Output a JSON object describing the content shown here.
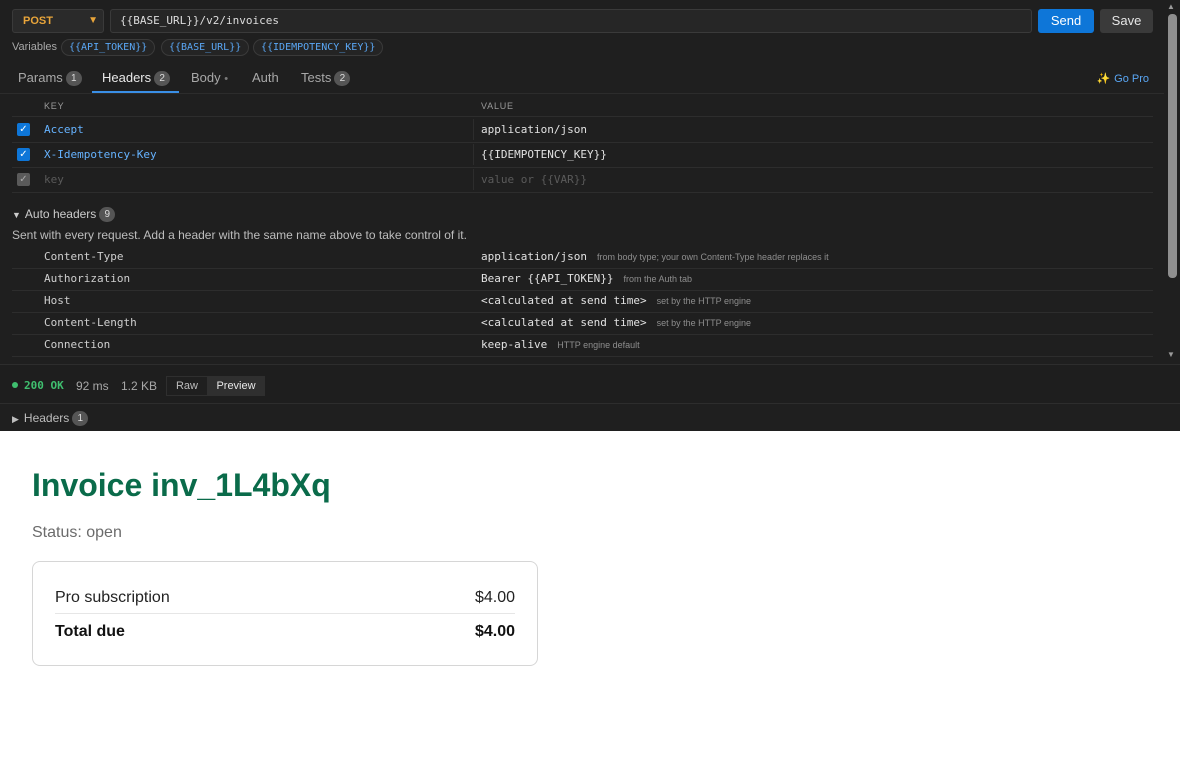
{
  "request": {
    "method": "POST",
    "url": "{{BASE_URL}}/v2/invoices",
    "send_label": "Send",
    "save_label": "Save"
  },
  "variables": {
    "label": "Variables",
    "items": [
      "{{API_TOKEN}}",
      "{{BASE_URL}}",
      "{{IDEMPOTENCY_KEY}}"
    ]
  },
  "tabs": [
    {
      "label": "Params",
      "badge": "1"
    },
    {
      "label": "Headers",
      "badge": "2",
      "active": true
    },
    {
      "label": "Body",
      "dot": "•"
    },
    {
      "label": "Auth"
    },
    {
      "label": "Tests",
      "badge": "2"
    }
  ],
  "go_pro": "Go Pro",
  "headers_table": {
    "col_key": "KEY",
    "col_value": "VALUE",
    "rows": [
      {
        "key": "Accept",
        "value": "application/json",
        "enabled": true
      },
      {
        "key": "X-Idempotency-Key",
        "value": "{{IDEMPOTENCY_KEY}}",
        "enabled": true
      }
    ],
    "placeholder_key": "key",
    "placeholder_value": "value or {{VAR}}"
  },
  "auto_headers": {
    "title": "Auto headers",
    "count": "9",
    "description": "Sent with every request. Add a header with the same name above to take control of it.",
    "rows": [
      {
        "key": "Content-Type",
        "value": "application/json",
        "note": "from body type; your own Content-Type header replaces it"
      },
      {
        "key": "Authorization",
        "value": "Bearer {{API_TOKEN}}",
        "note": "from the Auth tab"
      },
      {
        "key": "Host",
        "value": "<calculated at send time>",
        "note": "set by the HTTP engine"
      },
      {
        "key": "Content-Length",
        "value": "<calculated at send time>",
        "note": "set by the HTTP engine"
      },
      {
        "key": "Connection",
        "value": "keep-alive",
        "note": "HTTP engine default"
      }
    ]
  },
  "response": {
    "status": "200 OK",
    "time": "92 ms",
    "size": "1.2 KB",
    "view_raw": "Raw",
    "view_preview": "Preview",
    "headers_label": "Headers",
    "headers_count": "1"
  },
  "preview": {
    "title": "Invoice inv_1L4bXq",
    "status": "Status: open",
    "line_item": "Pro subscription",
    "line_amount": "$4.00",
    "total_label": "Total due",
    "total_amount": "$4.00"
  },
  "colors": {
    "accent": "#0e76d8",
    "method": "#e9a53a",
    "status_ok": "#3fbf6f",
    "invoice_title": "#0a6b4a"
  }
}
